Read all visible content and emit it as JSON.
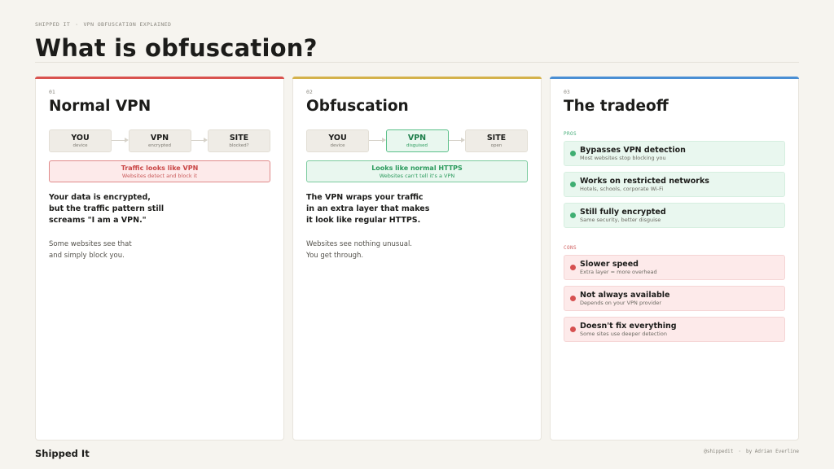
{
  "header": {
    "kicker_left": "SHIPPED IT",
    "kicker_sep": "·",
    "kicker_right": "VPN OBFUSCATION EXPLAINED",
    "title": "What is obfuscation?"
  },
  "colors": {
    "card1_accent": "#d9534f",
    "card2_accent": "#d4b24c",
    "card3_accent": "#4a8fd4",
    "pro_green": "#3fae72",
    "con_red": "#d65050"
  },
  "cards": [
    {
      "num": "01",
      "title": "Normal VPN",
      "flow": [
        {
          "label": "YOU",
          "sub": "device"
        },
        {
          "label": "VPN",
          "sub": "encrypted"
        },
        {
          "label": "SITE",
          "sub": "blocked?"
        }
      ],
      "status": {
        "title": "Traffic looks like VPN",
        "sub": "Websites detect and block it"
      },
      "bold_lines": [
        "Your data is encrypted,",
        "but the traffic pattern still",
        "screams \"I am a VPN.\""
      ],
      "light_lines": [
        "Some websites see that",
        "and simply block you."
      ]
    },
    {
      "num": "02",
      "title": "Obfuscation",
      "flow": [
        {
          "label": "YOU",
          "sub": "device"
        },
        {
          "label": "VPN",
          "sub": "disguised"
        },
        {
          "label": "SITE",
          "sub": "open"
        }
      ],
      "status": {
        "title": "Looks like normal HTTPS",
        "sub": "Websites can't tell it's a VPN"
      },
      "bold_lines": [
        "The VPN wraps your traffic",
        "in an extra layer that makes",
        "it look like regular HTTPS."
      ],
      "light_lines": [
        "Websites see nothing unusual.",
        "You get through."
      ]
    },
    {
      "num": "03",
      "title": "The tradeoff",
      "pros_label": "PROS",
      "pros": [
        {
          "title": "Bypasses VPN detection",
          "sub": "Most websites stop blocking you"
        },
        {
          "title": "Works on restricted networks",
          "sub": "Hotels, schools, corporate Wi-Fi"
        },
        {
          "title": "Still fully encrypted",
          "sub": "Same security, better disguise"
        }
      ],
      "cons_label": "CONS",
      "cons": [
        {
          "title": "Slower speed",
          "sub": "Extra layer = more overhead"
        },
        {
          "title": "Not always available",
          "sub": "Depends on your VPN provider"
        },
        {
          "title": "Doesn't fix everything",
          "sub": "Some sites use deeper detection"
        }
      ]
    }
  ],
  "footer": {
    "brand": "Shipped It",
    "handle": "@shippedit",
    "sep": "·",
    "credit": "by Adrian Everline"
  }
}
